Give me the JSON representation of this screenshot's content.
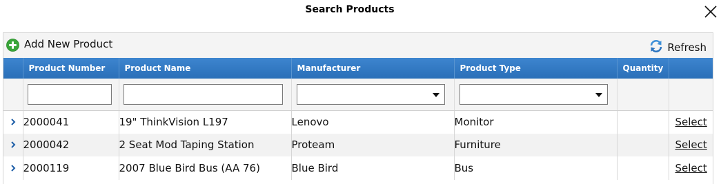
{
  "dialog": {
    "title": "Search Products"
  },
  "toolbar": {
    "add_label": "Add New Product",
    "refresh_label": "Refresh"
  },
  "columns": {
    "product_number": "Product Number",
    "product_name": "Product Name",
    "manufacturer": "Manufacturer",
    "product_type": "Product Type",
    "quantity": "Quantity"
  },
  "filters": {
    "product_number": "",
    "product_name": "",
    "manufacturer": "",
    "product_type": ""
  },
  "rows": [
    {
      "number": "2000041",
      "name": "19\" ThinkVision L197",
      "manufacturer": "Lenovo",
      "type": "Monitor",
      "quantity": "",
      "action": "Select"
    },
    {
      "number": "2000042",
      "name": "2 Seat Mod Taping Station",
      "manufacturer": "Proteam",
      "type": "Furniture",
      "quantity": "",
      "action": "Select"
    },
    {
      "number": "2000119",
      "name": "2007 Blue Bird Bus (AA 76)",
      "manufacturer": "Blue Bird",
      "type": "Bus",
      "quantity": "",
      "action": "Select"
    }
  ],
  "icons": {
    "close": "close-icon",
    "add": "plus-circle-icon",
    "refresh": "refresh-icon",
    "expand": "chevron-right-icon",
    "dropdown": "caret-down-icon"
  },
  "colors": {
    "header_bg": "#2f76c0",
    "add_icon": "#3aa63a",
    "refresh_icon": "#3d8fd8"
  }
}
